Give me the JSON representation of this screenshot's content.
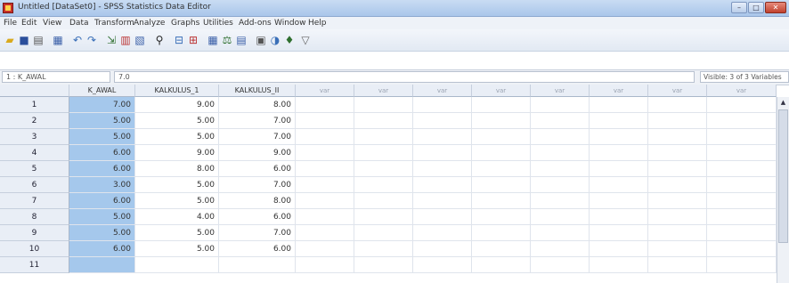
{
  "window": {
    "title": "Untitled [DataSet0] - SPSS Statistics Data Editor",
    "buttons": {
      "minimize": "–",
      "maximize": "□",
      "close": "✕"
    }
  },
  "menu": [
    "File",
    "Edit",
    "View",
    "Data",
    "Transform",
    "Analyze",
    "Graphs",
    "Utilities",
    "Add-ons",
    "Window",
    "Help"
  ],
  "toolbar_icons": [
    "open-folder",
    "save-disk",
    "print",
    "dialog-recall",
    "undo",
    "redo",
    "goto-case",
    "goto-variable",
    "variables",
    "find",
    "insert-cases",
    "insert-variable",
    "split-file",
    "weight-cases",
    "select-cases",
    "value-labels",
    "use-sets",
    "show-all"
  ],
  "cell_editor": {
    "reference": "1 : K_AWAL",
    "value": "7.0",
    "visible": "Visible: 3 of 3 Variables"
  },
  "grid": {
    "columns": [
      "K_AWAL",
      "KALKULUS_1",
      "KALKULUS_II",
      "var",
      "var",
      "var",
      "var",
      "var",
      "var",
      "var",
      "var"
    ],
    "rows": [
      {
        "n": "1",
        "cells": [
          "7.00",
          "9.00",
          "8.00"
        ]
      },
      {
        "n": "2",
        "cells": [
          "5.00",
          "5.00",
          "7.00"
        ]
      },
      {
        "n": "3",
        "cells": [
          "5.00",
          "5.00",
          "7.00"
        ]
      },
      {
        "n": "4",
        "cells": [
          "6.00",
          "9.00",
          "9.00"
        ]
      },
      {
        "n": "5",
        "cells": [
          "6.00",
          "8.00",
          "6.00"
        ]
      },
      {
        "n": "6",
        "cells": [
          "3.00",
          "5.00",
          "7.00"
        ]
      },
      {
        "n": "7",
        "cells": [
          "6.00",
          "5.00",
          "8.00"
        ]
      },
      {
        "n": "8",
        "cells": [
          "5.00",
          "4.00",
          "6.00"
        ]
      },
      {
        "n": "9",
        "cells": [
          "5.00",
          "5.00",
          "7.00"
        ]
      },
      {
        "n": "10",
        "cells": [
          "6.00",
          "5.00",
          "6.00"
        ]
      },
      {
        "n": "11",
        "cells": [
          "",
          "",
          ""
        ]
      }
    ]
  },
  "colors": {
    "selected_column": "#a5c8ec",
    "header_bg": "#e9eef6"
  }
}
